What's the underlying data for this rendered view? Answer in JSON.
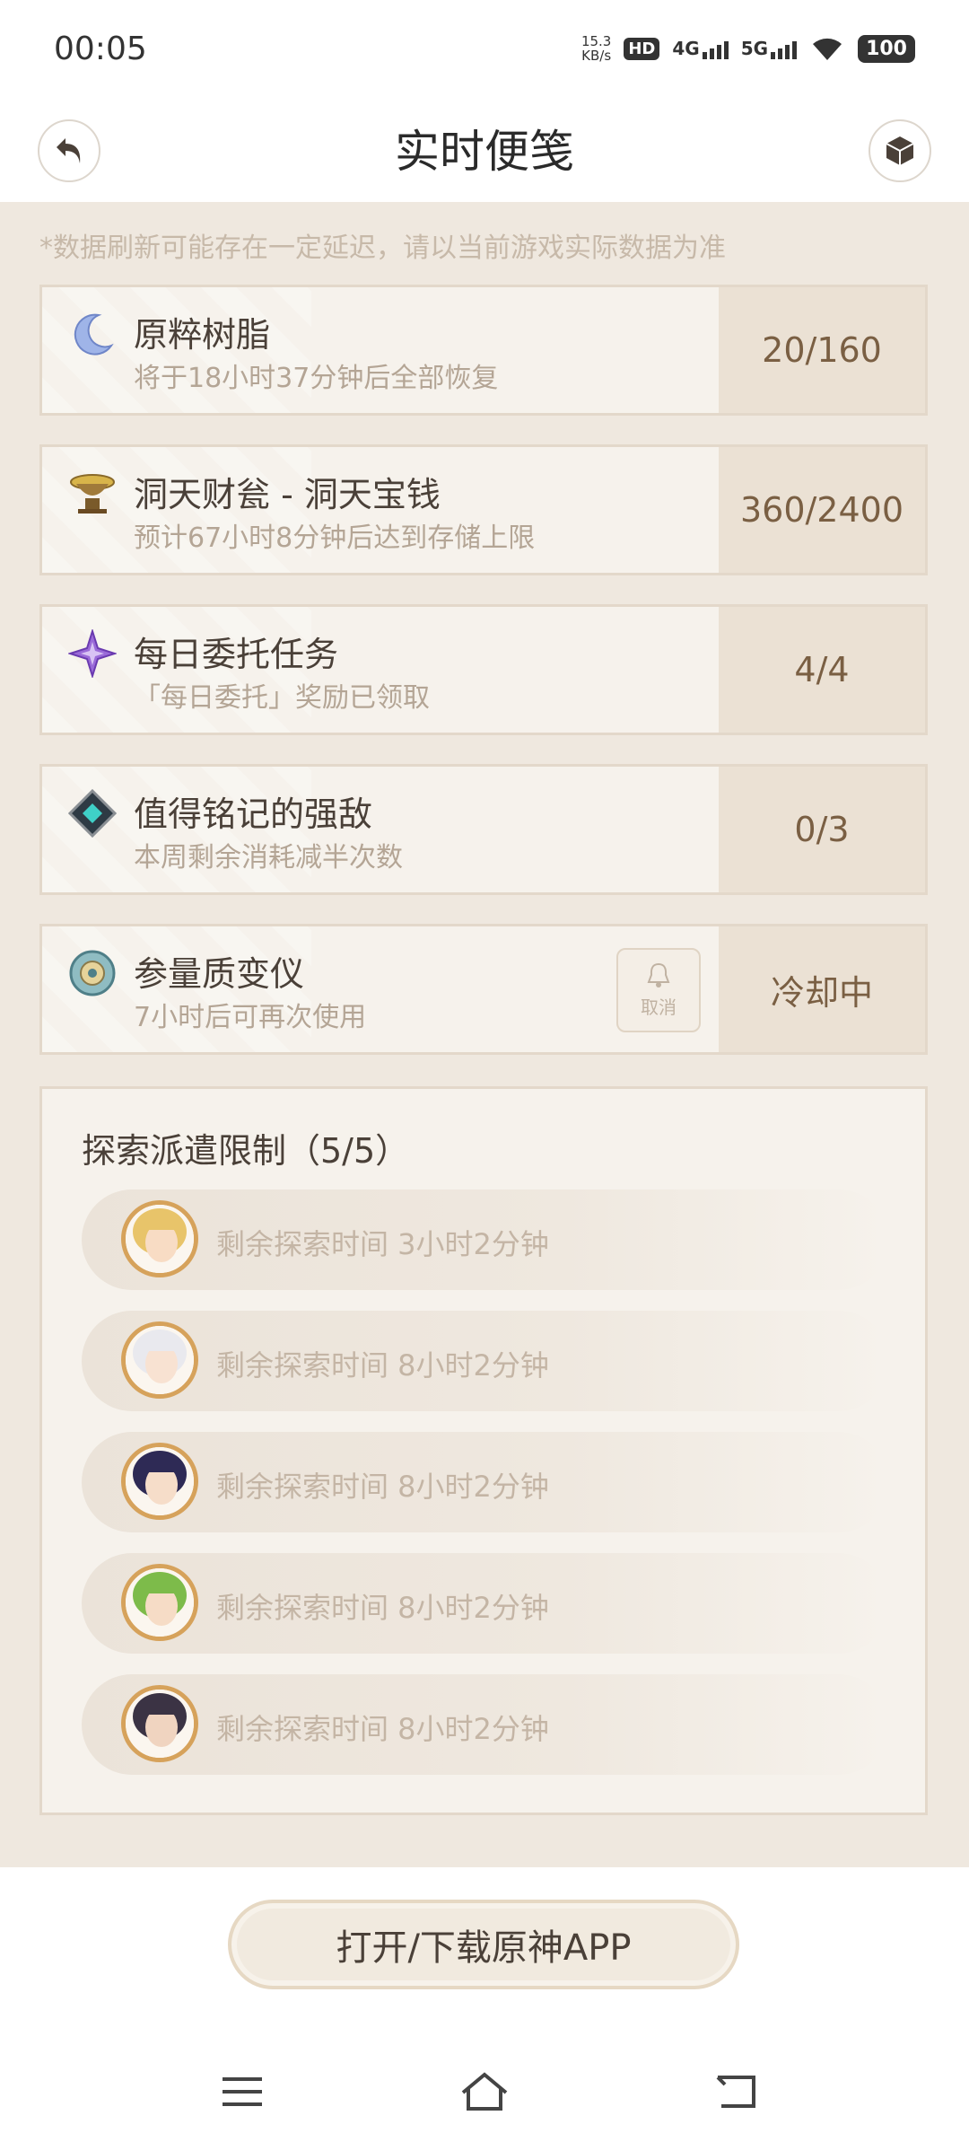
{
  "status": {
    "time": "00:05",
    "speed_value": "15.3",
    "speed_unit": "KB/s",
    "hd_label": "HD",
    "net1": "4G",
    "net2": "5G",
    "battery": "100"
  },
  "header": {
    "title": "实时便笺",
    "back_icon": "back-arrow-icon",
    "right_icon": "cube-icon"
  },
  "notice": "*数据刷新可能存在一定延迟，请以当前游戏实际数据为准",
  "cards": [
    {
      "name": "原粹树脂",
      "desc": "将于18小时37分钟后全部恢复",
      "value": "20/160",
      "icon": "moon-resin-icon"
    },
    {
      "name": "洞天财瓮 - 洞天宝钱",
      "desc": "预计67小时8分钟后达到存储上限",
      "value": "360/2400",
      "icon": "treasure-pot-icon"
    },
    {
      "name": "每日委托任务",
      "desc": "「每日委托」奖励已领取",
      "value": "4/4",
      "icon": "commission-star-icon"
    },
    {
      "name": "值得铭记的强敌",
      "desc": "本周剩余消耗减半次数",
      "value": "0/3",
      "icon": "weekly-boss-icon"
    },
    {
      "name": "参量质变仪",
      "desc": "7小时后可再次使用",
      "value": "冷却中",
      "icon": "transformer-icon",
      "cancel_label": "取消"
    }
  ],
  "expedition": {
    "title": "探索派遣限制（5/5）",
    "items": [
      {
        "text": "剩余探索时间 3小时2分钟",
        "hair": "#e8c46a",
        "skin": "#f8dcc4"
      },
      {
        "text": "剩余探索时间 8小时2分钟",
        "hair": "#e9e9ee",
        "skin": "#f8e2d2"
      },
      {
        "text": "剩余探索时间 8小时2分钟",
        "hair": "#2e2a55",
        "skin": "#f6ddc9"
      },
      {
        "text": "剩余探索时间 8小时2分钟",
        "hair": "#7dbb4a",
        "skin": "#f6dcc6"
      },
      {
        "text": "剩余探索时间 8小时2分钟",
        "hair": "#3b3344",
        "skin": "#f0d4c0"
      }
    ]
  },
  "footer": {
    "open_app_label": "打开/下载原神APP"
  },
  "navbar": {
    "menu_icon": "menu-icon",
    "home_icon": "home-icon",
    "back_icon": "back-icon"
  }
}
